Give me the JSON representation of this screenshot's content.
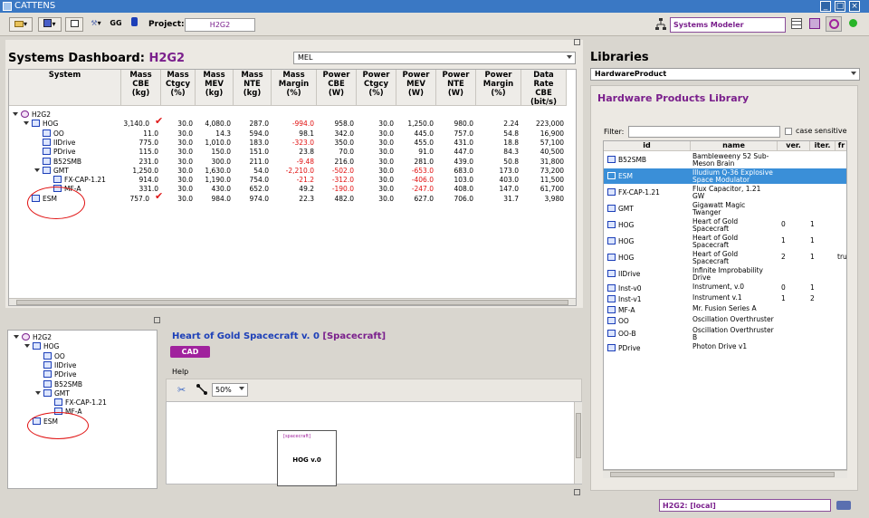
{
  "window": {
    "title": "CATTENS"
  },
  "toolbar": {
    "project_label": "Project:",
    "project_value": "H2G2",
    "gg_label": "GG",
    "modeler_value": "Systems Modeler"
  },
  "dashboard": {
    "title_prefix": "Systems Dashboard:",
    "title_project": "H2G2",
    "mode_value": "MEL",
    "columns": [
      {
        "l1": "System",
        "l2": "",
        "l3": "",
        "l4": ""
      },
      {
        "l1": "Mass",
        "l2": "CBE",
        "l3": "(kg)",
        "l4": ""
      },
      {
        "l1": "Mass",
        "l2": "Ctgcy",
        "l3": "(%)",
        "l4": ""
      },
      {
        "l1": "Mass",
        "l2": "MEV",
        "l3": "(kg)",
        "l4": ""
      },
      {
        "l1": "Mass",
        "l2": "NTE",
        "l3": "(kg)",
        "l4": ""
      },
      {
        "l1": "Mass",
        "l2": "Margin",
        "l3": "(%)",
        "l4": ""
      },
      {
        "l1": "Power",
        "l2": "CBE",
        "l3": "(W)",
        "l4": ""
      },
      {
        "l1": "Power",
        "l2": "Ctgcy",
        "l3": "(%)",
        "l4": ""
      },
      {
        "l1": "Power",
        "l2": "MEV",
        "l3": "(W)",
        "l4": ""
      },
      {
        "l1": "Power",
        "l2": "NTE",
        "l3": "(W)",
        "l4": ""
      },
      {
        "l1": "Power",
        "l2": "Margin",
        "l3": "(%)",
        "l4": ""
      },
      {
        "l1": "Data",
        "l2": "Rate",
        "l3": "CBE",
        "l4": "(bit/s)"
      }
    ],
    "rows": [
      {
        "name": "H2G2",
        "level": 0,
        "expand": true,
        "icon": "project-icon",
        "check": false,
        "vals": [
          "",
          "",
          "",
          "",
          "",
          "",
          "",
          "",
          "",
          "",
          ""
        ],
        "neg": []
      },
      {
        "name": "HOG",
        "level": 1,
        "expand": true,
        "icon": "cube-icon",
        "check": true,
        "vals": [
          "3,140.0",
          "30.0",
          "4,080.0",
          "287.0",
          "-994.0",
          "958.0",
          "30.0",
          "1,250.0",
          "980.0",
          "2.24",
          "223,000"
        ],
        "neg": [
          4
        ]
      },
      {
        "name": "OO",
        "level": 2,
        "expand": false,
        "icon": "cube-icon",
        "check": false,
        "vals": [
          "11.0",
          "30.0",
          "14.3",
          "594.0",
          "98.1",
          "342.0",
          "30.0",
          "445.0",
          "757.0",
          "54.8",
          "16,900"
        ],
        "neg": []
      },
      {
        "name": "IIDrive",
        "level": 2,
        "expand": false,
        "icon": "cube-icon",
        "check": false,
        "vals": [
          "775.0",
          "30.0",
          "1,010.0",
          "183.0",
          "-323.0",
          "350.0",
          "30.0",
          "455.0",
          "431.0",
          "18.8",
          "57,100"
        ],
        "neg": [
          4
        ]
      },
      {
        "name": "PDrive",
        "level": 2,
        "expand": false,
        "icon": "cube-icon",
        "check": false,
        "vals": [
          "115.0",
          "30.0",
          "150.0",
          "151.0",
          "23.8",
          "70.0",
          "30.0",
          "91.0",
          "447.0",
          "84.3",
          "40,500"
        ],
        "neg": []
      },
      {
        "name": "B52SMB",
        "level": 2,
        "expand": false,
        "icon": "cube-icon",
        "check": false,
        "vals": [
          "231.0",
          "30.0",
          "300.0",
          "211.0",
          "-9.48",
          "216.0",
          "30.0",
          "281.0",
          "439.0",
          "50.8",
          "31,800"
        ],
        "neg": [
          4
        ]
      },
      {
        "name": "GMT",
        "level": 2,
        "expand": true,
        "icon": "cube-icon",
        "check": false,
        "vals": [
          "1,250.0",
          "30.0",
          "1,630.0",
          "54.0",
          "-2,210.0",
          "-502.0",
          "30.0",
          "-653.0",
          "683.0",
          "173.0",
          "73,200"
        ],
        "neg": [
          4,
          5,
          7
        ]
      },
      {
        "name": "FX-CAP-1.21",
        "level": 3,
        "expand": false,
        "icon": "cube-icon",
        "check": false,
        "vals": [
          "914.0",
          "30.0",
          "1,190.0",
          "754.0",
          "-21.2",
          "-312.0",
          "30.0",
          "-406.0",
          "103.0",
          "403.0",
          "11,500"
        ],
        "neg": [
          4,
          5,
          7
        ]
      },
      {
        "name": "MF-A",
        "level": 3,
        "expand": false,
        "icon": "cube-icon",
        "check": false,
        "vals": [
          "331.0",
          "30.0",
          "430.0",
          "652.0",
          "49.2",
          "-190.0",
          "30.0",
          "-247.0",
          "408.0",
          "147.0",
          "61,700"
        ],
        "neg": [
          5,
          7
        ]
      },
      {
        "name": "ESM",
        "level": 1,
        "expand": false,
        "icon": "cube-icon",
        "check": true,
        "vals": [
          "757.0",
          "30.0",
          "984.0",
          "974.0",
          "22.3",
          "482.0",
          "30.0",
          "627.0",
          "706.0",
          "31.7",
          "3,980"
        ],
        "neg": []
      }
    ]
  },
  "tree": {
    "nodes": [
      {
        "name": "H2G2",
        "level": 0,
        "expand": true,
        "icon": "project-icon"
      },
      {
        "name": "HOG",
        "level": 1,
        "expand": true,
        "icon": "cube-icon"
      },
      {
        "name": "OO",
        "level": 2,
        "expand": false,
        "icon": "cube-icon"
      },
      {
        "name": "IIDrive",
        "level": 2,
        "expand": false,
        "icon": "cube-icon"
      },
      {
        "name": "PDrive",
        "level": 2,
        "expand": false,
        "icon": "cube-icon"
      },
      {
        "name": "B52SMB",
        "level": 2,
        "expand": false,
        "icon": "cube-icon"
      },
      {
        "name": "GMT",
        "level": 2,
        "expand": true,
        "icon": "cube-icon"
      },
      {
        "name": "FX-CAP-1.21",
        "level": 3,
        "expand": false,
        "icon": "cube-icon"
      },
      {
        "name": "MF-A",
        "level": 3,
        "expand": false,
        "icon": "cube-icon"
      },
      {
        "name": "ESM",
        "level": 1,
        "expand": false,
        "icon": "cube-icon"
      }
    ]
  },
  "detail": {
    "title": "Heart of Gold Spacecraft v. 0",
    "type_label": "[Spacecraft]",
    "cad_label": "CAD",
    "help_label": "Help",
    "zoom_value": "50%",
    "block_type": "[spacecraft]",
    "block_name": "HOG v.0"
  },
  "libraries": {
    "title": "Libraries",
    "selector_value": "HardwareProduct",
    "library_title": "Hardware Products Library",
    "filter_label": "Filter:",
    "filter_value": "",
    "case_label": "case sensitive",
    "columns": [
      "id",
      "name",
      "ver.",
      "iter.",
      "fr"
    ],
    "rows": [
      {
        "id": "B52SMB",
        "name": [
          "Bambleweeny 52 Sub-",
          "Meson Brain"
        ],
        "ver": "",
        "iter": "",
        "fr": "",
        "selected": false
      },
      {
        "id": "ESM",
        "name": [
          "Illudium Q-36 Explosive",
          "Space Modulator"
        ],
        "ver": "",
        "iter": "",
        "fr": "",
        "selected": true
      },
      {
        "id": "FX-CAP-1.21",
        "name": [
          "Flux Capacitor, 1.21",
          "GW"
        ],
        "ver": "",
        "iter": "",
        "fr": "",
        "selected": false
      },
      {
        "id": "GMT",
        "name": [
          "Gigawatt Magic",
          "Twanger"
        ],
        "ver": "",
        "iter": "",
        "fr": "",
        "selected": false
      },
      {
        "id": "HOG",
        "name": [
          "Heart of Gold",
          "Spacecraft"
        ],
        "ver": "0",
        "iter": "1",
        "fr": "",
        "selected": false
      },
      {
        "id": "HOG",
        "name": [
          "Heart of Gold",
          "Spacecraft"
        ],
        "ver": "1",
        "iter": "1",
        "fr": "",
        "selected": false
      },
      {
        "id": "HOG",
        "name": [
          "Heart of Gold",
          "Spacecraft"
        ],
        "ver": "2",
        "iter": "1",
        "fr": "tru",
        "selected": false
      },
      {
        "id": "IIDrive",
        "name": [
          "Infinite Improbability",
          "Drive"
        ],
        "ver": "",
        "iter": "",
        "fr": "",
        "selected": false
      },
      {
        "id": "Inst-v0",
        "name": [
          "Instrument, v.0",
          ""
        ],
        "ver": "0",
        "iter": "1",
        "fr": "",
        "selected": false
      },
      {
        "id": "Inst-v1",
        "name": [
          "Instrument v.1",
          ""
        ],
        "ver": "1",
        "iter": "2",
        "fr": "",
        "selected": false
      },
      {
        "id": "MF-A",
        "name": [
          "Mr. Fusion Series A",
          ""
        ],
        "ver": "",
        "iter": "",
        "fr": "",
        "selected": false
      },
      {
        "id": "OO",
        "name": [
          "Oscillation Overthruster",
          ""
        ],
        "ver": "",
        "iter": "",
        "fr": "",
        "selected": false
      },
      {
        "id": "OO-B",
        "name": [
          "Oscillation Overthruster",
          "B"
        ],
        "ver": "",
        "iter": "",
        "fr": "",
        "selected": false
      },
      {
        "id": "PDrive",
        "name": [
          "Photon Drive v1",
          ""
        ],
        "ver": "",
        "iter": "",
        "fr": "",
        "selected": false
      }
    ]
  },
  "statusbar": {
    "value": "H2G2: [local]"
  },
  "colors": {
    "accent": "#7a1f8c",
    "selection": "#3a8fd8",
    "negative": "#e01010",
    "titlebar": "#3a78c4"
  }
}
